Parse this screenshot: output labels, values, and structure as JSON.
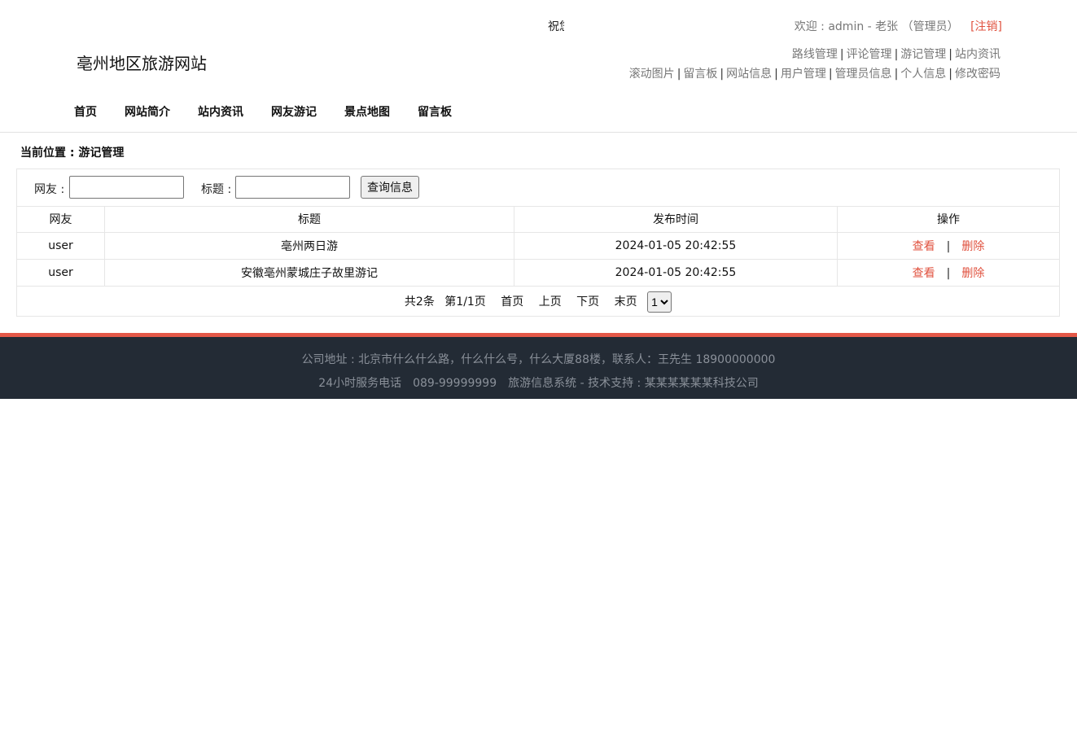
{
  "header": {
    "site_title": "亳州地区旅游网站",
    "marquee_text": "祝您旅途愉快",
    "welcome_prefix": "欢迎 : admin - 老张 （管理员）",
    "logout": "[注销]",
    "admin_links_row1": [
      "路线管理",
      "评论管理",
      "游记管理",
      "站内资讯"
    ],
    "admin_links_row2": [
      "滚动图片",
      "留言板",
      "网站信息",
      "用户管理",
      "管理员信息",
      "个人信息",
      "修改密码"
    ]
  },
  "nav": [
    "首页",
    "网站简介",
    "站内资讯",
    "网友游记",
    "景点地图",
    "留言板"
  ],
  "breadcrumb": "当前位置 : 游记管理",
  "search": {
    "user_label": "网友 :",
    "title_label": "标题 :",
    "button": "查询信息",
    "user_value": "",
    "title_value": ""
  },
  "table": {
    "headers": [
      "网友",
      "标题",
      "发布时间",
      "操作"
    ],
    "rows": [
      {
        "user": "user",
        "title": "亳州两日游",
        "time": "2024-01-05 20:42:55",
        "view": "查看",
        "sep": "|",
        "delete": "删除"
      },
      {
        "user": "user",
        "title": "安徽亳州蒙城庄子故里游记",
        "time": "2024-01-05 20:42:55",
        "view": "查看",
        "sep": "|",
        "delete": "删除"
      }
    ]
  },
  "pager": {
    "total": "共2条",
    "page": "第1/1页",
    "first": "首页",
    "prev": "上页",
    "next": "下页",
    "last": "末页",
    "select_value": "1"
  },
  "footer": {
    "line1": "公司地址 : 北京市什么什么路，什么什么号，什么大厦88楼，联系人：王先生 18900000000",
    "line2": "24小时服务电话　089-99999999　旅游信息系统 - 技术支持 : 某某某某某某科技公司"
  },
  "colors": {
    "accent": "#e0523f",
    "footer_bg": "#232b35",
    "footer_border": "#e35848"
  }
}
